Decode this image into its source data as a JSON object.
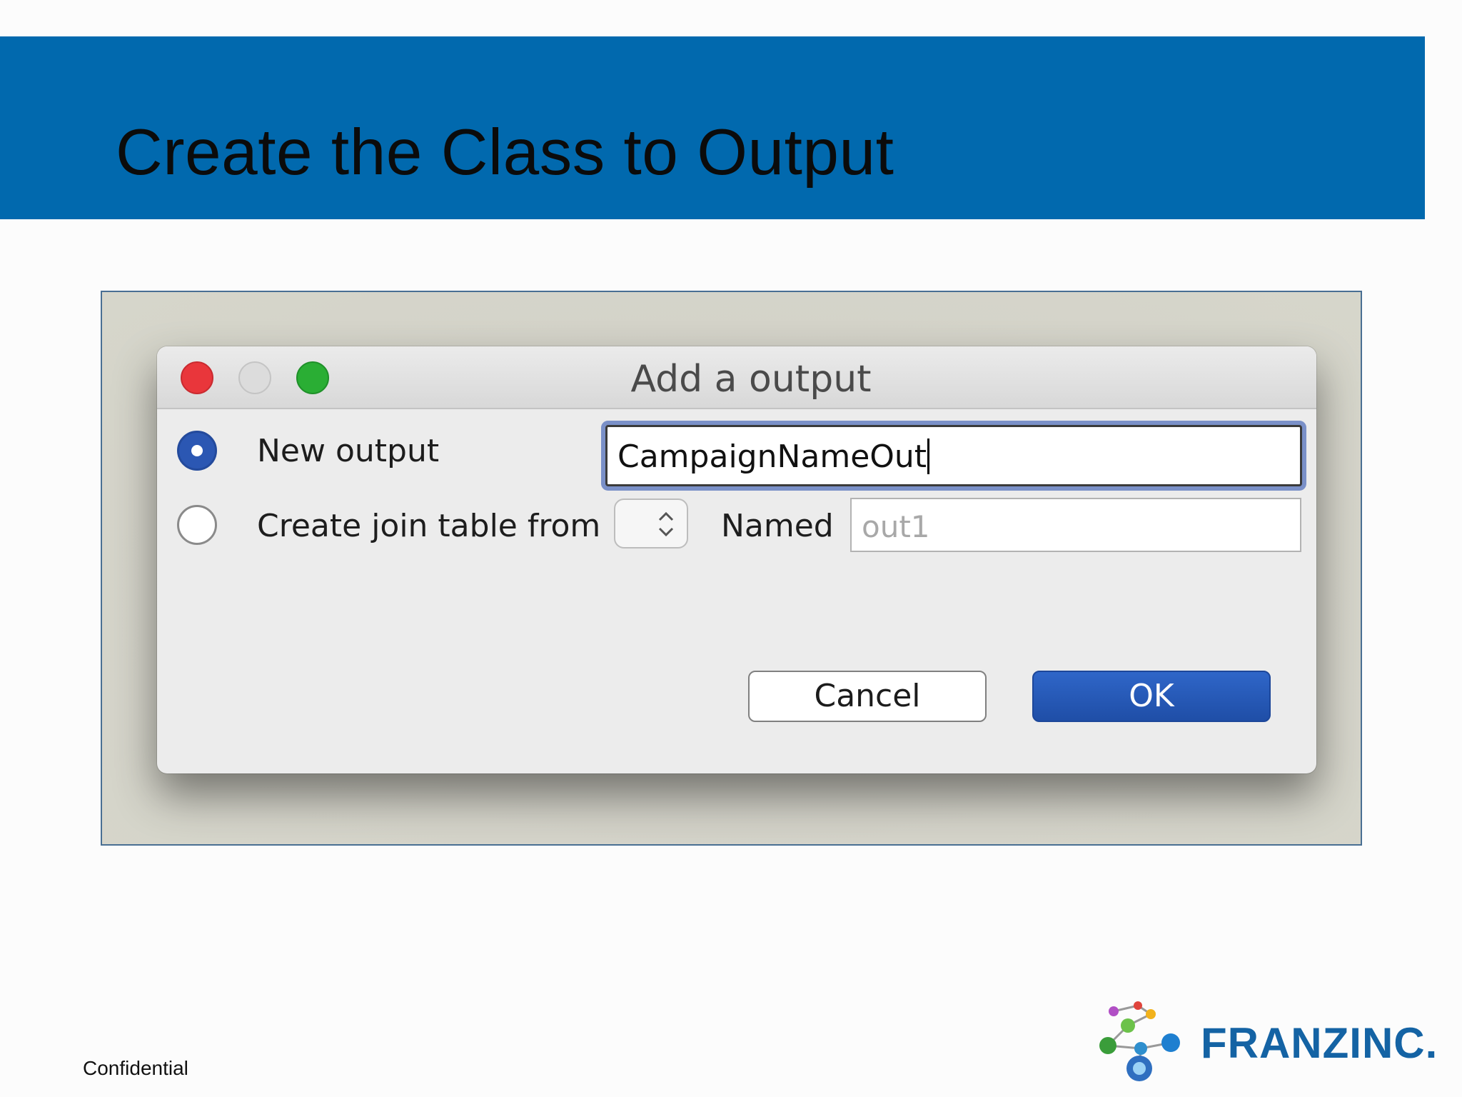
{
  "slide": {
    "title": "Create the Class to Output",
    "footer": "Confidential",
    "logo_text": "FRANZINC.",
    "header_color": "#0169ae"
  },
  "dialog": {
    "title": "Add a output",
    "window_controls": [
      "close",
      "minimize",
      "zoom"
    ],
    "options": {
      "new_output_label": "New output",
      "new_output_selected": true,
      "join_table_label": "Create join table from",
      "join_table_selected": false
    },
    "output_name_value": "CampaignNameOut",
    "join_table_selection": "",
    "named_label": "Named",
    "named_placeholder": "out1",
    "cancel_label": "Cancel",
    "ok_label": "OK",
    "accent_color": "#2b57b3"
  },
  "icons": {
    "stepper": "updown-chevron-icon",
    "logo": "molecule-icon"
  }
}
